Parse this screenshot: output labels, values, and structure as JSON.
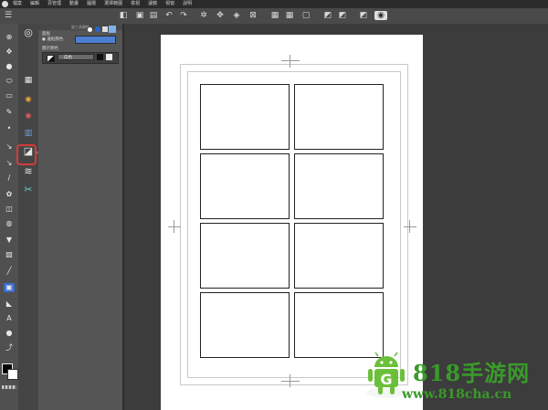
{
  "menubar": {
    "items": [
      "檔案",
      "編輯",
      "頁管理",
      "動畫",
      "圖層",
      "選擇範圍",
      "檢視",
      "濾鏡",
      "視窗",
      "說明"
    ]
  },
  "tool_property": {
    "title": "副工具屬性",
    "main_label": "面板",
    "border_color_label": "● 邊框顏色",
    "fill_label": "圖示顏色",
    "fill_value": "白色"
  },
  "watermark": {
    "brand": "818手游网",
    "url": "www.818cha.cn",
    "logo_letter": "G"
  },
  "colors": {
    "accent_blue": "#4c7fd1",
    "highlight_red": "#d63a3a",
    "watermark_green": "#3a9a2a"
  },
  "icons": [
    "hand-icon",
    "move-icon",
    "lasso-icon",
    "eyedropper-icon",
    "pen-icon",
    "pencil-icon",
    "brush-icon",
    "airbrush-icon",
    "eraser-icon",
    "fill-icon",
    "gradient-icon",
    "figure-icon",
    "frame-border-icon",
    "ruler-icon",
    "text-icon",
    "balloon-icon",
    "color-swatch-icon"
  ]
}
